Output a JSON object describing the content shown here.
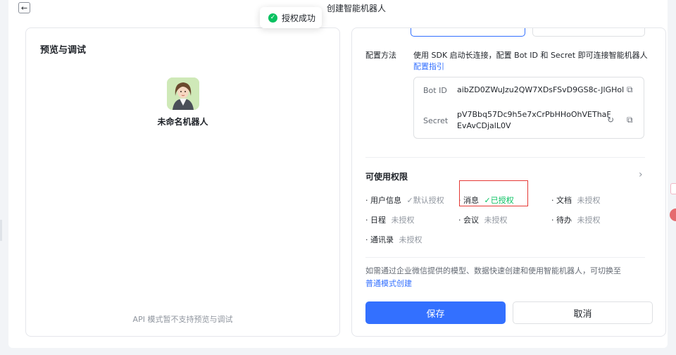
{
  "dialog": {
    "title": "创建智能机器人",
    "back_icon": "arrow-left-icon"
  },
  "toast": {
    "icon": "check-circle-icon",
    "text": "授权成功",
    "color": "#07c160"
  },
  "preview": {
    "title": "预览与调试",
    "bot_name": "未命名机器人",
    "footer_note": "API 模式暂不支持预览与调试"
  },
  "config": {
    "label": "配置方法",
    "description": "使用 SDK 启动长连接，配置 Bot ID 和 Secret 即可连接智能机器人",
    "guide_link": "配置指引",
    "bot_id_label": "Bot ID",
    "bot_id_value": "aibZD0ZWuJzu2QW7XDsFSvD9GS8c-JlGHol",
    "secret_label": "Secret",
    "secret_value_line1": "pV7Bbq57Dc9h5e7xCrPbHHoOhVEThaF",
    "secret_value_line2": "EvAvCDjalL0V"
  },
  "permissions": {
    "title": "可使用权限",
    "items": [
      {
        "name": "用户信息",
        "status": "默认授权",
        "state": "default"
      },
      {
        "name": "消息",
        "status": "已授权",
        "state": "granted"
      },
      {
        "name": "文档",
        "status": "未授权",
        "state": "none"
      },
      {
        "name": "日程",
        "status": "未授权",
        "state": "none"
      },
      {
        "name": "会议",
        "status": "未授权",
        "state": "none"
      },
      {
        "name": "待办",
        "status": "未授权",
        "state": "none"
      },
      {
        "name": "通讯录",
        "status": "未授权",
        "state": "none"
      }
    ]
  },
  "switch_note": {
    "text": "如需通过企业微信提供的模型、数据快速创建和使用智能机器人，可切换至",
    "link": "普通模式创建"
  },
  "actions": {
    "save_label": "保存",
    "cancel_label": "取消"
  },
  "colors": {
    "accent": "#3370ff",
    "success": "#07c160",
    "highlight": "#e53935"
  }
}
